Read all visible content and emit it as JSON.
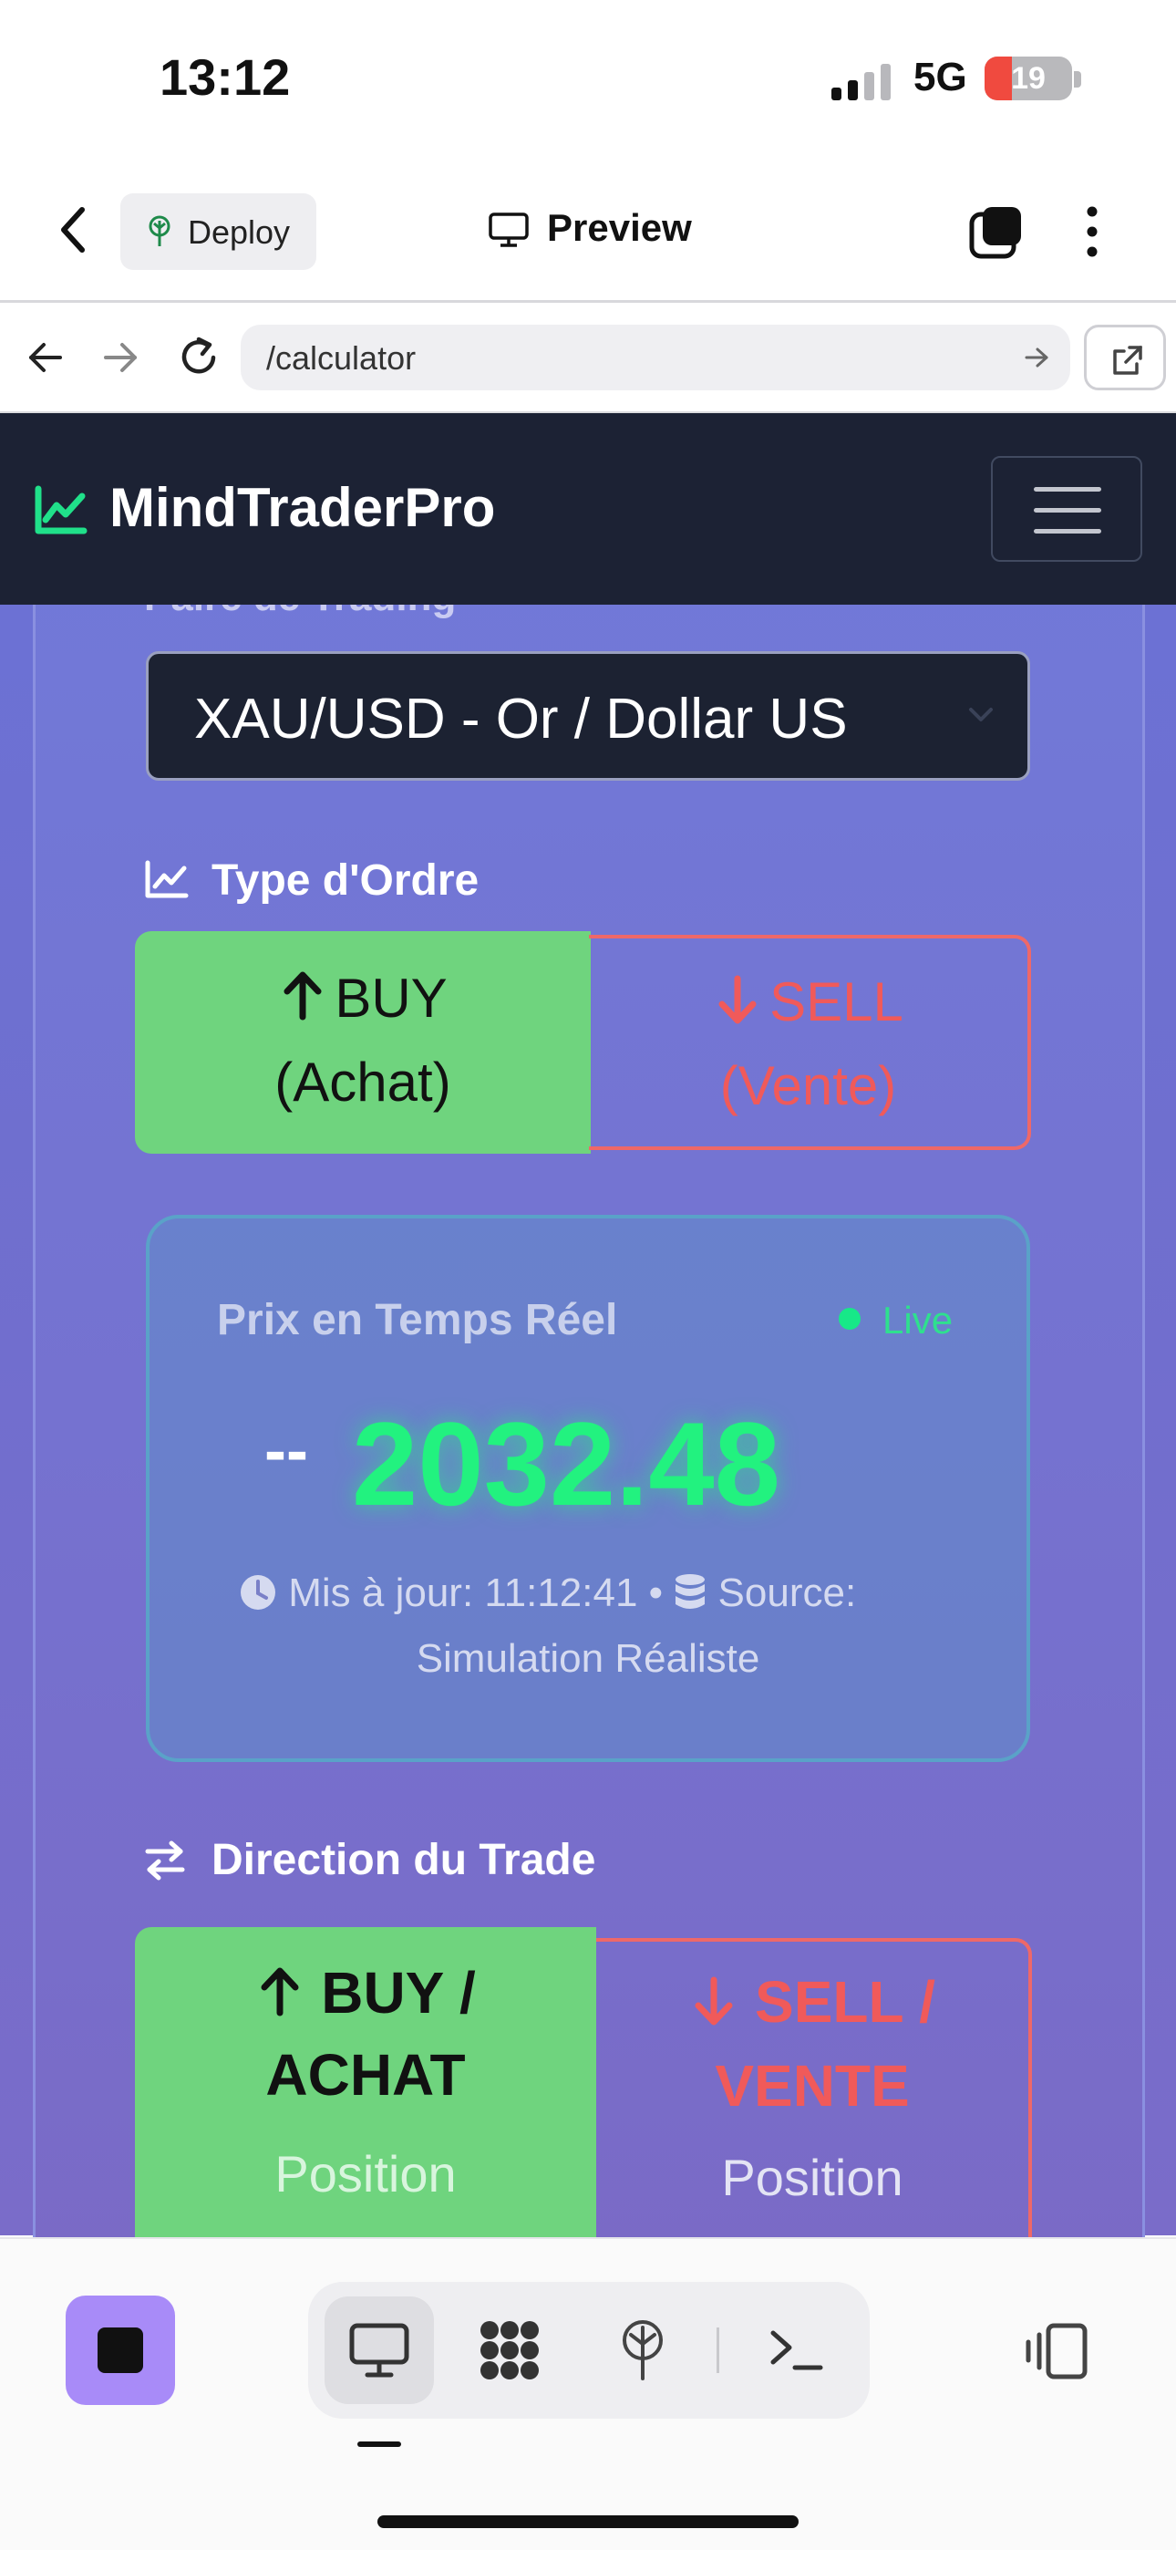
{
  "status_bar": {
    "time": "13:12",
    "network": "5G",
    "battery": "19"
  },
  "toolbar": {
    "deploy_label": "Deploy",
    "preview_label": "Preview"
  },
  "browser": {
    "url": "/calculator"
  },
  "site": {
    "brand": "MindTraderPro"
  },
  "calculator": {
    "pair_section_title": "Paire de Trading",
    "pair_value": "XAU/USD - Or / Dollar US",
    "order_type_title": "Type d'Ordre",
    "buy_line1": "BUY",
    "buy_line2": "(Achat)",
    "sell_line1": "SELL",
    "sell_line2": "(Vente)",
    "price_panel": {
      "title": "Prix en Temps Réel",
      "live_label": "Live",
      "change": "--",
      "price": "2032.48",
      "updated_label": "Mis à jour: 11:12:41",
      "separator": "•",
      "source_label": "Source:",
      "source_value": "Simulation Réaliste"
    },
    "direction_title": "Direction du Trade",
    "dir_buy_line1": "BUY /",
    "dir_buy_line2": "ACHAT",
    "dir_buy_sub": "Position",
    "dir_sell_line1": "SELL /",
    "dir_sell_line2": "VENTE",
    "dir_sell_sub": "Position"
  },
  "colors": {
    "buy_green": "#6fd47e",
    "sell_red": "#ee6868",
    "price_green": "#22f27f",
    "header_dark": "#1c2234",
    "accent_purple": "#a88bf8"
  },
  "icons": [
    "back-chevron-icon",
    "tree-icon",
    "monitor-icon",
    "tabs-icon",
    "kebab-icon",
    "arrow-left-icon",
    "arrow-right-icon",
    "reload-icon",
    "external-link-icon",
    "chart-line-icon",
    "menu-icon",
    "chevron-down-icon",
    "arrow-up-icon",
    "arrow-down-icon",
    "clock-icon",
    "database-icon",
    "swap-icon",
    "stop-icon",
    "grid-icon",
    "terminal-icon",
    "rotate-device-icon"
  ]
}
